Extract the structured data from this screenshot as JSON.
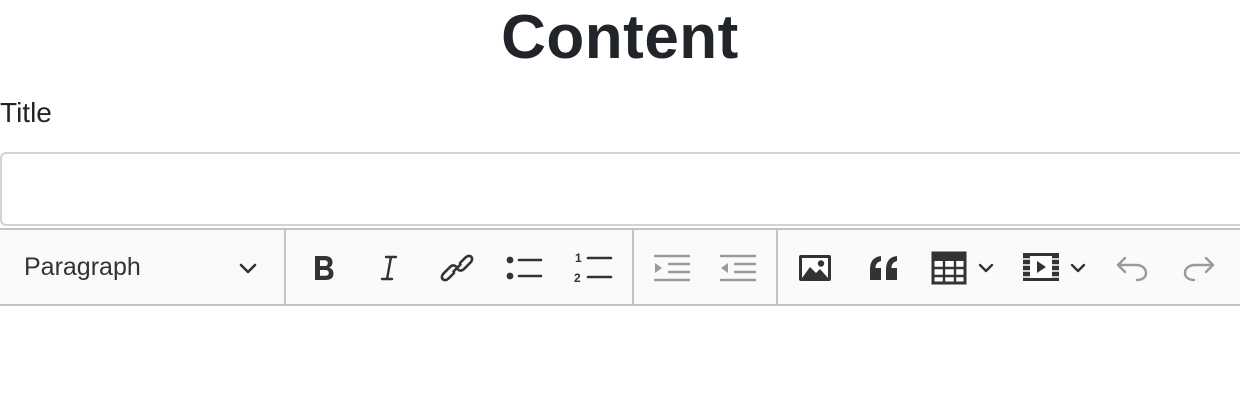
{
  "page": {
    "heading": "Content"
  },
  "title_field": {
    "label": "Title",
    "value": "",
    "placeholder": ""
  },
  "toolbar": {
    "heading_select": {
      "selected": "Paragraph"
    },
    "buttons": [
      {
        "name": "bold",
        "icon": "bold-icon",
        "enabled": true
      },
      {
        "name": "italic",
        "icon": "italic-icon",
        "enabled": true
      },
      {
        "name": "link",
        "icon": "link-icon",
        "enabled": true
      },
      {
        "name": "bulleted-list",
        "icon": "bulleted-list-icon",
        "enabled": true
      },
      {
        "name": "numbered-list",
        "icon": "numbered-list-icon",
        "enabled": true
      },
      {
        "name": "increase-indent",
        "icon": "indent-icon",
        "enabled": false
      },
      {
        "name": "decrease-indent",
        "icon": "outdent-icon",
        "enabled": false
      },
      {
        "name": "insert-image",
        "icon": "image-icon",
        "enabled": true
      },
      {
        "name": "block-quote",
        "icon": "quote-icon",
        "enabled": true
      },
      {
        "name": "insert-table",
        "icon": "table-icon",
        "enabled": true
      },
      {
        "name": "insert-media",
        "icon": "media-icon",
        "enabled": true
      },
      {
        "name": "undo",
        "icon": "undo-icon",
        "enabled": false
      },
      {
        "name": "redo",
        "icon": "redo-icon",
        "enabled": false
      }
    ]
  },
  "colors": {
    "text": "#212529",
    "icon": "#333333",
    "icon_disabled": "#9a9a9a",
    "toolbar_bg": "#fafafa",
    "border": "#c4c4c4"
  }
}
